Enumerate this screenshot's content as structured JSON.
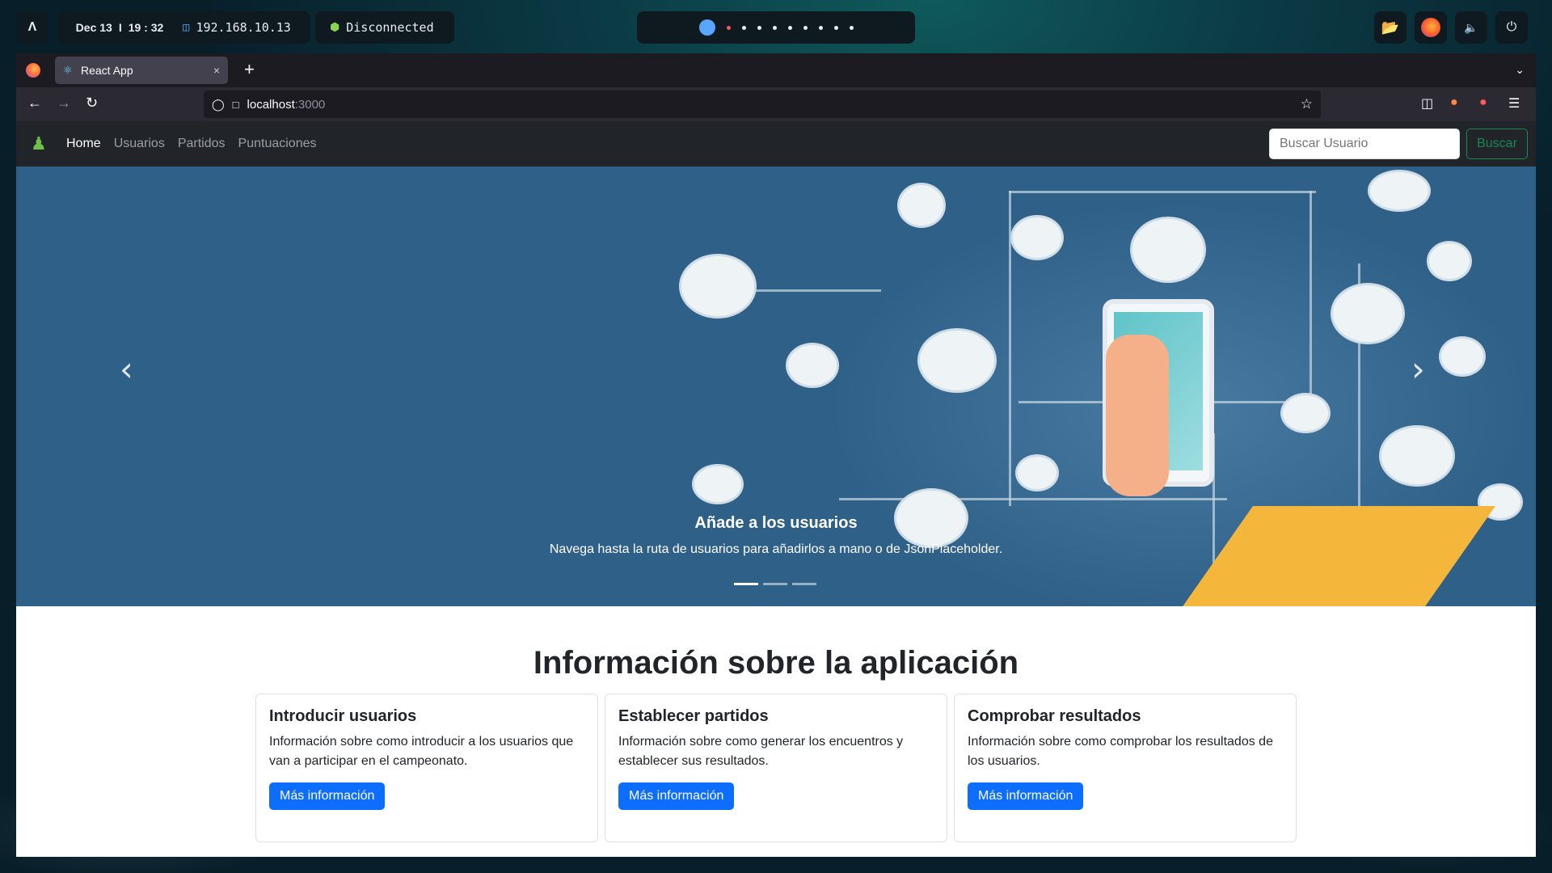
{
  "system_bar": {
    "logo": "Λ",
    "date": "Dec 13",
    "separator": "I",
    "time": "19 : 32",
    "ip": "192.168.10.13",
    "vpn_status": "Disconnected",
    "workspaces": 10
  },
  "browser": {
    "tab_title": "React App",
    "tab_close": "×",
    "new_tab": "+",
    "url_host": "localhost",
    "url_port": ":3000"
  },
  "app": {
    "nav": {
      "links": [
        "Home",
        "Usuarios",
        "Partidos",
        "Puntuaciones"
      ],
      "active": "Home",
      "search_placeholder": "Buscar Usuario",
      "search_button": "Buscar"
    },
    "carousel": {
      "caption_title": "Añade a los usuarios",
      "caption_text": "Navega hasta la ruta de usuarios para añadirlos a mano o de JsonPlaceholder.",
      "slides": 3,
      "active_slide": 1,
      "prev": "‹",
      "next": "›"
    },
    "section_title": "Información sobre la aplicación",
    "cards": [
      {
        "title": "Introducir usuarios",
        "text": "Información sobre como introducir a los usuarios que van a participar en el campeonato.",
        "button": "Más información"
      },
      {
        "title": "Establecer partidos",
        "text": "Información sobre como generar los encuentros y establecer sus resultados.",
        "button": "Más información"
      },
      {
        "title": "Comprobar resultados",
        "text": "Información sobre como comprobar los resultados de los usuarios.",
        "button": "Más información"
      }
    ]
  },
  "colors": {
    "navbar_bg": "#212529",
    "primary": "#0d6efd",
    "success": "#198754",
    "carousel_bg": "#2f6088"
  },
  "icons": [
    "arch-logo-icon",
    "network-icon",
    "vpn-icon",
    "folder-icon",
    "firefox-icon",
    "volume-icon",
    "power-icon",
    "back-icon",
    "forward-icon",
    "reload-icon",
    "shield-icon",
    "page-icon",
    "star-icon",
    "pocket-icon",
    "extension-icon",
    "menu-icon",
    "chess-pawn-icon",
    "chevron-left-icon",
    "chevron-right-icon"
  ]
}
